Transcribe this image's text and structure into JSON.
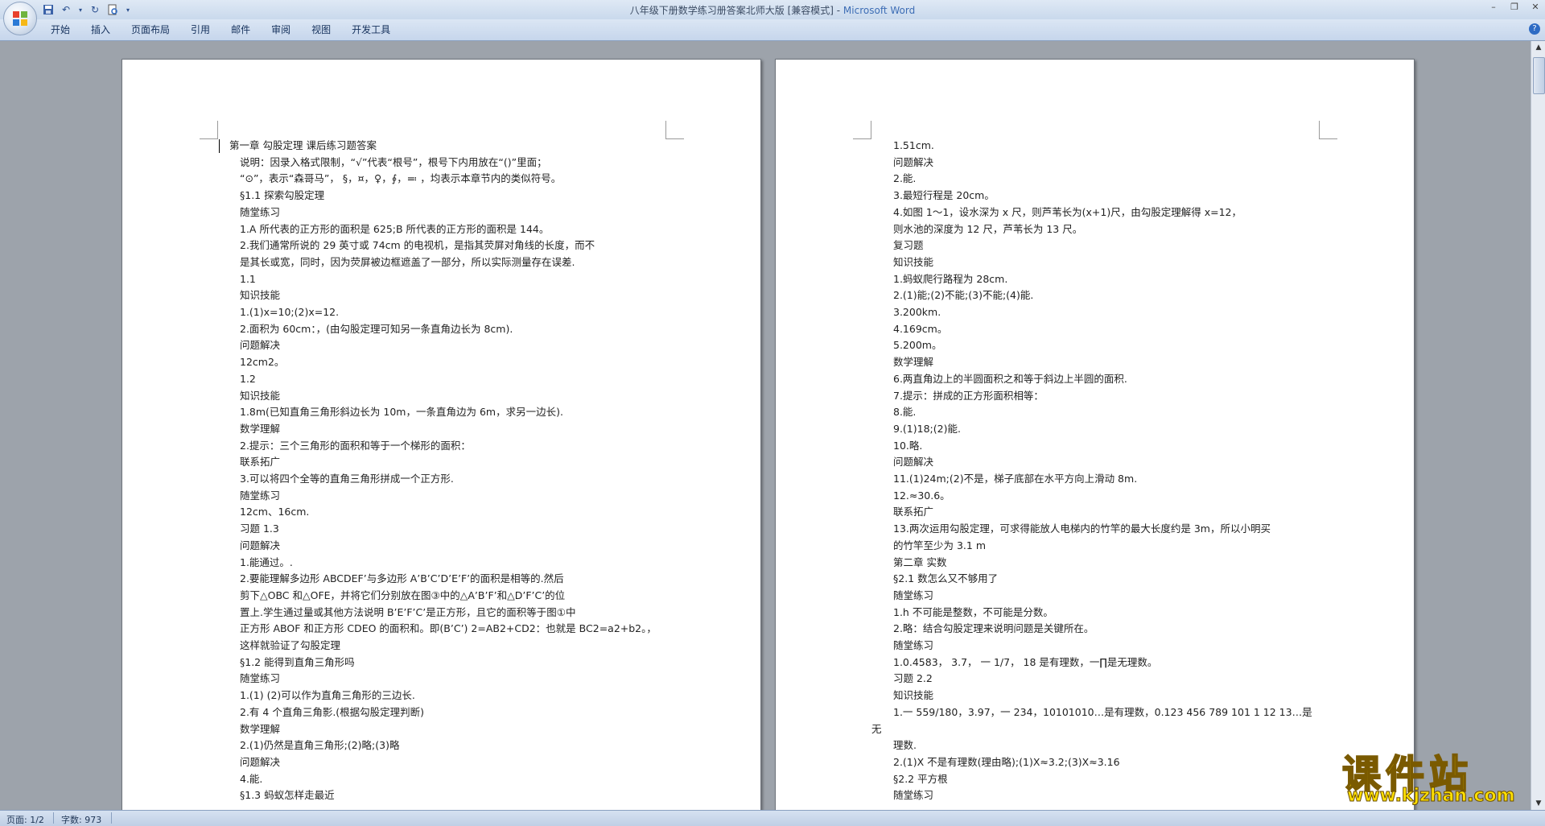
{
  "window": {
    "title_doc": "八年级下册数学练习册答案北师大版 [兼容模式] - ",
    "title_app": "Microsoft Word"
  },
  "ribbon": {
    "tabs": [
      "开始",
      "插入",
      "页面布局",
      "引用",
      "邮件",
      "审阅",
      "视图",
      "开发工具"
    ]
  },
  "pages": [
    {
      "lines": [
        "第一章 勾股定理 课后练习题答案",
        "说明：因录入格式限制，“√”代表“根号”，根号下内用放在“()”里面；",
        "“⊙”，表示“森哥马”， §，¤，♀，∮，≕ ，均表示本章节内的类似符号。",
        "§1.1 探索勾股定理",
        "随堂练习",
        "1.A 所代表的正方形的面积是 625;B 所代表的正方形的面积是 144。",
        "2.我们通常所说的 29 英寸或 74cm 的电视机，是指其荧屏对角线的长度，而不",
        "是其长或宽，同时，因为荧屏被边框遮盖了一部分，所以实际测量存在误差.",
        "1.1",
        "知识技能",
        "1.(1)x=10;(2)x=12.",
        "2.面积为 60cm：，(由勾股定理可知另一条直角边长为 8cm).",
        "问题解决",
        "12cm2。",
        "1.2",
        "知识技能",
        "1.8m(已知直角三角形斜边长为 10m，一条直角边为 6m，求另一边长).",
        "数学理解",
        "2.提示：三个三角形的面积和等于一个梯形的面积：",
        "联系拓广",
        "3.可以将四个全等的直角三角形拼成一个正方形.",
        "随堂练习",
        "12cm、16cm.",
        "习题 1.3",
        "问题解决",
        "1.能通过。.",
        "2.要能理解多边形 ABCDEF’与多边形 A’B’C’D’E’F’的面积是相等的.然后",
        "剪下△OBC 和△OFE，并将它们分别放在图③中的△A’B’F’和△D’F’C’的位",
        "置上.学生通过量或其他方法说明 B’E’F’C’是正方形，且它的面积等于图①中",
        "正方形 ABOF 和正方形 CDEO 的面积和。即(B’C’) 2=AB2+CD2：也就是 BC2=a2+b2。，",
        "这样就验证了勾股定理",
        "§1.2 能得到直角三角形吗",
        "随堂练习",
        "1.(1) (2)可以作为直角三角形的三边长.",
        "2.有 4 个直角三角影.(根据勾股定理判断)",
        "数学理解",
        "2.(1)仍然是直角三角形;(2)略;(3)略",
        "问题解决",
        "4.能.",
        "§1.3 蚂蚁怎样走最近"
      ]
    },
    {
      "lines": [
        "1.51cm.",
        "问题解决",
        "2.能.",
        "3.最短行程是 20cm。",
        "4.如图 1～1，设水深为 x 尺，则芦苇长为(x+1)尺，由勾股定理解得 x=12，",
        "则水池的深度为 12 尺，芦苇长为 13 尺。",
        "复习题",
        "知识技能",
        "1.蚂蚁爬行路程为 28cm.",
        "2.(1)能;(2)不能;(3)不能;(4)能.",
        "3.200km.",
        "4.169cm。",
        "5.200m。",
        "数学理解",
        "6.两直角边上的半圆面积之和等于斜边上半圆的面积.",
        "7.提示：拼成的正方形面积相等：",
        "8.能.",
        "9.(1)18;(2)能.",
        "10.略.",
        "问题解决",
        "11.(1)24m;(2)不是，梯子底部在水平方向上滑动 8m.",
        "12.≈30.6。",
        "联系拓广",
        "13.两次运用勾股定理，可求得能放人电梯内的竹竿的最大长度约是 3m，所以小明买",
        "的竹竿至少为 3.1 m",
        "第二章 实数",
        "§2.1 数怎么又不够用了",
        "随堂练习",
        "1.h 不可能是整数，不可能是分数。",
        "2.略：结合勾股定理来说明问题是关键所在。",
        "随堂练习",
        "1.0.4583， 3.7， 一 1/7， 18 是有理数，一∏是无理数。",
        "习题 2.2",
        "知识技能",
        "1.一 559/180，3.97，一 234，10101010…是有理数，0.123 456 789 101 1 12 13…是",
        "无",
        "理数.",
        "2.(1)X 不是有理数(理由略);(1)X≈3.2;(3)X≈3.16",
        "§2.2 平方根",
        "随堂练习"
      ]
    }
  ],
  "status": {
    "page": "页面: 1/2",
    "words": "字数: 973"
  },
  "watermark": {
    "title": "课件站",
    "url": "www.kjzhan.com"
  }
}
